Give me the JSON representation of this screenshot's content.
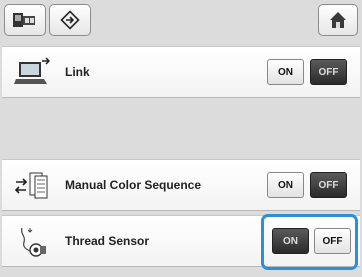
{
  "toolbar": {
    "left_icons": [
      "embroidery-machine-icon",
      "diamond-arrow-icon"
    ],
    "home_icon": "home-icon"
  },
  "rows": [
    {
      "label": "Link",
      "icon": "computer-link-icon",
      "on_label": "ON",
      "off_label": "OFF",
      "selected": "OFF"
    },
    {
      "label": "Manual Color Sequence",
      "icon": "color-sequence-icon",
      "on_label": "ON",
      "off_label": "OFF",
      "selected": "OFF"
    },
    {
      "label": "Thread Sensor",
      "icon": "thread-sensor-icon",
      "on_label": "ON",
      "off_label": "OFF",
      "selected": "ON"
    }
  ],
  "colors": {
    "highlight": "#2d8fd8",
    "selected_button": "#3a3a3a"
  }
}
